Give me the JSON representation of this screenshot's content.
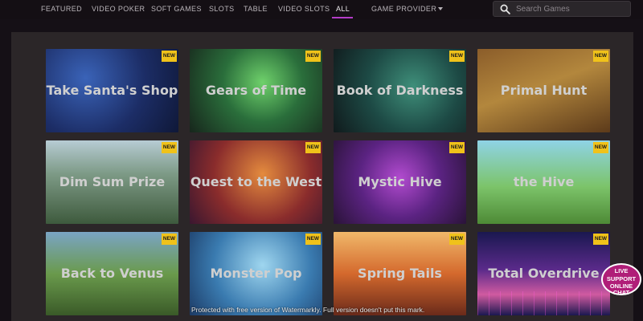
{
  "nav": {
    "items": [
      "FEATURED",
      "VIDEO POKER",
      "SOFT GAMES",
      "SLOTS",
      "TABLE",
      "VIDEO SLOTS",
      "ALL",
      "GAME PROVIDER"
    ],
    "active": "ALL"
  },
  "search": {
    "placeholder": "Search Games",
    "value": ""
  },
  "tiles": [
    {
      "title": "Take Santa's Shop",
      "badge": "NEW"
    },
    {
      "title": "Gears of Time",
      "badge": "NEW"
    },
    {
      "title": "Book of Darkness",
      "badge": "NEW"
    },
    {
      "title": "Primal Hunt",
      "badge": "NEW"
    },
    {
      "title": "Dim Sum Prize",
      "badge": "NEW"
    },
    {
      "title": "Quest to the West",
      "badge": "NEW"
    },
    {
      "title": "Mystic Hive",
      "badge": "NEW"
    },
    {
      "title": "the Hive",
      "badge": "NEW"
    },
    {
      "title": "Back to Venus",
      "badge": "NEW"
    },
    {
      "title": "Monster Pop",
      "badge": "NEW"
    },
    {
      "title": "Spring Tails",
      "badge": "NEW"
    },
    {
      "title": "Total Overdrive",
      "badge": "NEW"
    }
  ],
  "watermark": "Protected with free version of Watermarkly. Full version doesn't put this mark.",
  "support": {
    "line1": "LIVE",
    "line2": "SUPPORT",
    "line3": "ONLINE CHAT"
  },
  "colors": {
    "accent": "#b43cc8",
    "badge": "#f0c21a",
    "background": "#151016",
    "panel": "#2b2628"
  }
}
